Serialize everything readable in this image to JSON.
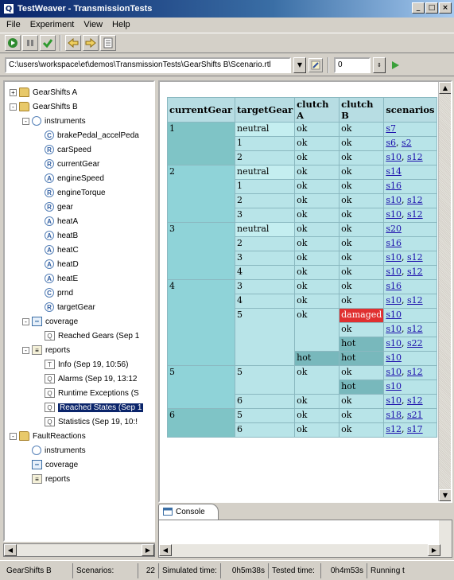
{
  "window": {
    "title": "TestWeaver - TransmissionTests"
  },
  "menu": [
    "File",
    "Experiment",
    "View",
    "Help"
  ],
  "path_bar": {
    "path": "C:\\users\\workspace\\et\\demos\\TransmissionTests\\GearShifts B\\Scenario.rtl",
    "number": "0"
  },
  "tree": [
    {
      "label": "GearShifts A",
      "icon": "folder-icon",
      "depth": 0,
      "exp": "+"
    },
    {
      "label": "GearShifts B",
      "icon": "folder-icon",
      "depth": 0,
      "exp": "-"
    },
    {
      "label": "instruments",
      "icon": "instruments-icon",
      "badge": "",
      "depth": 1,
      "exp": "-"
    },
    {
      "label": "brakePedal_accelPeda",
      "icon": "circle-icon",
      "badge": "C",
      "depth": 2
    },
    {
      "label": "carSpeed",
      "icon": "circle-icon",
      "badge": "R",
      "depth": 2
    },
    {
      "label": "currentGear",
      "icon": "circle-icon",
      "badge": "R",
      "depth": 2
    },
    {
      "label": "engineSpeed",
      "icon": "circle-icon",
      "badge": "A",
      "depth": 2
    },
    {
      "label": "engineTorque",
      "icon": "circle-icon",
      "badge": "R",
      "depth": 2
    },
    {
      "label": "gear",
      "icon": "circle-icon",
      "badge": "R",
      "depth": 2
    },
    {
      "label": "heatA",
      "icon": "circle-icon",
      "badge": "A",
      "depth": 2
    },
    {
      "label": "heatB",
      "icon": "circle-icon",
      "badge": "A",
      "depth": 2
    },
    {
      "label": "heatC",
      "icon": "circle-icon",
      "badge": "A",
      "depth": 2
    },
    {
      "label": "heatD",
      "icon": "circle-icon",
      "badge": "A",
      "depth": 2
    },
    {
      "label": "heatE",
      "icon": "circle-icon",
      "badge": "A",
      "depth": 2
    },
    {
      "label": "prnd",
      "icon": "circle-icon",
      "badge": "C",
      "depth": 2
    },
    {
      "label": "targetGear",
      "icon": "circle-icon",
      "badge": "R",
      "depth": 2
    },
    {
      "label": "coverage",
      "icon": "coverage-icon",
      "depth": 1,
      "exp": "-"
    },
    {
      "label": "Reached Gears (Sep 1",
      "icon": "doc-icon",
      "badge": "Q",
      "depth": 2
    },
    {
      "label": "reports",
      "icon": "reports-icon",
      "depth": 1,
      "exp": "-"
    },
    {
      "label": "Info (Sep 19, 10:56)",
      "icon": "doc-icon",
      "badge": "T",
      "depth": 2
    },
    {
      "label": "Alarms (Sep 19, 13:12",
      "icon": "doc-icon",
      "badge": "Q",
      "depth": 2
    },
    {
      "label": "Runtime Exceptions (S",
      "icon": "doc-icon",
      "badge": "Q",
      "depth": 2
    },
    {
      "label": "Reached States (Sep 1",
      "icon": "doc-icon",
      "badge": "Q",
      "depth": 2,
      "selected": true
    },
    {
      "label": "Statistics (Sep 19, 10:!",
      "icon": "doc-icon",
      "badge": "Q",
      "depth": 2
    },
    {
      "label": "FaultReactions",
      "icon": "folder-icon",
      "depth": 0,
      "exp": "-"
    },
    {
      "label": "instruments",
      "icon": "instruments-icon",
      "badge": "",
      "depth": 1
    },
    {
      "label": "coverage",
      "icon": "coverage-icon",
      "depth": 1
    },
    {
      "label": "reports",
      "icon": "reports-icon",
      "depth": 1
    }
  ],
  "table": {
    "headers": [
      "currentGear",
      "targetGear",
      "clutch A",
      "clutch B",
      "scenarios"
    ],
    "rows": [
      [
        "1",
        "neutral",
        "ok",
        "ok",
        [
          "s7"
        ]
      ],
      [
        "",
        "1",
        "ok",
        "ok",
        [
          "s6",
          "s2"
        ]
      ],
      [
        "",
        "2",
        "ok",
        "ok",
        [
          "s10",
          "s12"
        ]
      ],
      [
        "2",
        "neutral",
        "ok",
        "ok",
        [
          "s14"
        ]
      ],
      [
        "",
        "1",
        "ok",
        "ok",
        [
          "s16"
        ]
      ],
      [
        "",
        "2",
        "ok",
        "ok",
        [
          "s10",
          "s12"
        ]
      ],
      [
        "",
        "3",
        "ok",
        "ok",
        [
          "s10",
          "s12"
        ]
      ],
      [
        "3",
        "neutral",
        "ok",
        "ok",
        [
          "s20"
        ]
      ],
      [
        "",
        "2",
        "ok",
        "ok",
        [
          "s16"
        ]
      ],
      [
        "",
        "3",
        "ok",
        "ok",
        [
          "s10",
          "s12"
        ]
      ],
      [
        "",
        "4",
        "ok",
        "ok",
        [
          "s10",
          "s12"
        ]
      ],
      [
        "4",
        "3",
        "ok",
        "ok",
        [
          "s16"
        ]
      ],
      [
        "",
        "4",
        "ok",
        "ok",
        [
          "s10",
          "s12"
        ]
      ],
      [
        "",
        "5",
        "ok",
        "damaged",
        [
          "s10"
        ]
      ],
      [
        "",
        "",
        "",
        "ok",
        [
          "s10",
          "s12"
        ]
      ],
      [
        "",
        "",
        "",
        "hot",
        [
          "s10",
          "s22"
        ]
      ],
      [
        "",
        "",
        "hot",
        "hot",
        [
          "s10"
        ]
      ],
      [
        "5",
        "5",
        "ok",
        "ok",
        [
          "s10",
          "s12"
        ]
      ],
      [
        "",
        "",
        "",
        "hot",
        [
          "s10"
        ]
      ],
      [
        "",
        "6",
        "ok",
        "ok",
        [
          "s10",
          "s12"
        ]
      ],
      [
        "6",
        "5",
        "ok",
        "ok",
        [
          "s18",
          "s21"
        ]
      ],
      [
        "",
        "6",
        "ok",
        "ok",
        [
          "s12",
          "s17"
        ]
      ]
    ]
  },
  "console": {
    "tab_label": "Console"
  },
  "status": {
    "folder": "GearShifts B",
    "scenarios_label": "Scenarios:",
    "scenarios_value": "22",
    "sim_label": "Simulated time:",
    "sim_value": "0h5m38s",
    "tested_label": "Tested time:",
    "tested_value": "0h4m53s",
    "running": "Running t"
  },
  "colors": {
    "cell_light": "#b8e4e8",
    "cell_mid": "#8fd3d8",
    "cell_dark": "#7fc4c6",
    "damaged": "#e03030",
    "hot": "#78b8bc",
    "selection": "#0a246a"
  }
}
